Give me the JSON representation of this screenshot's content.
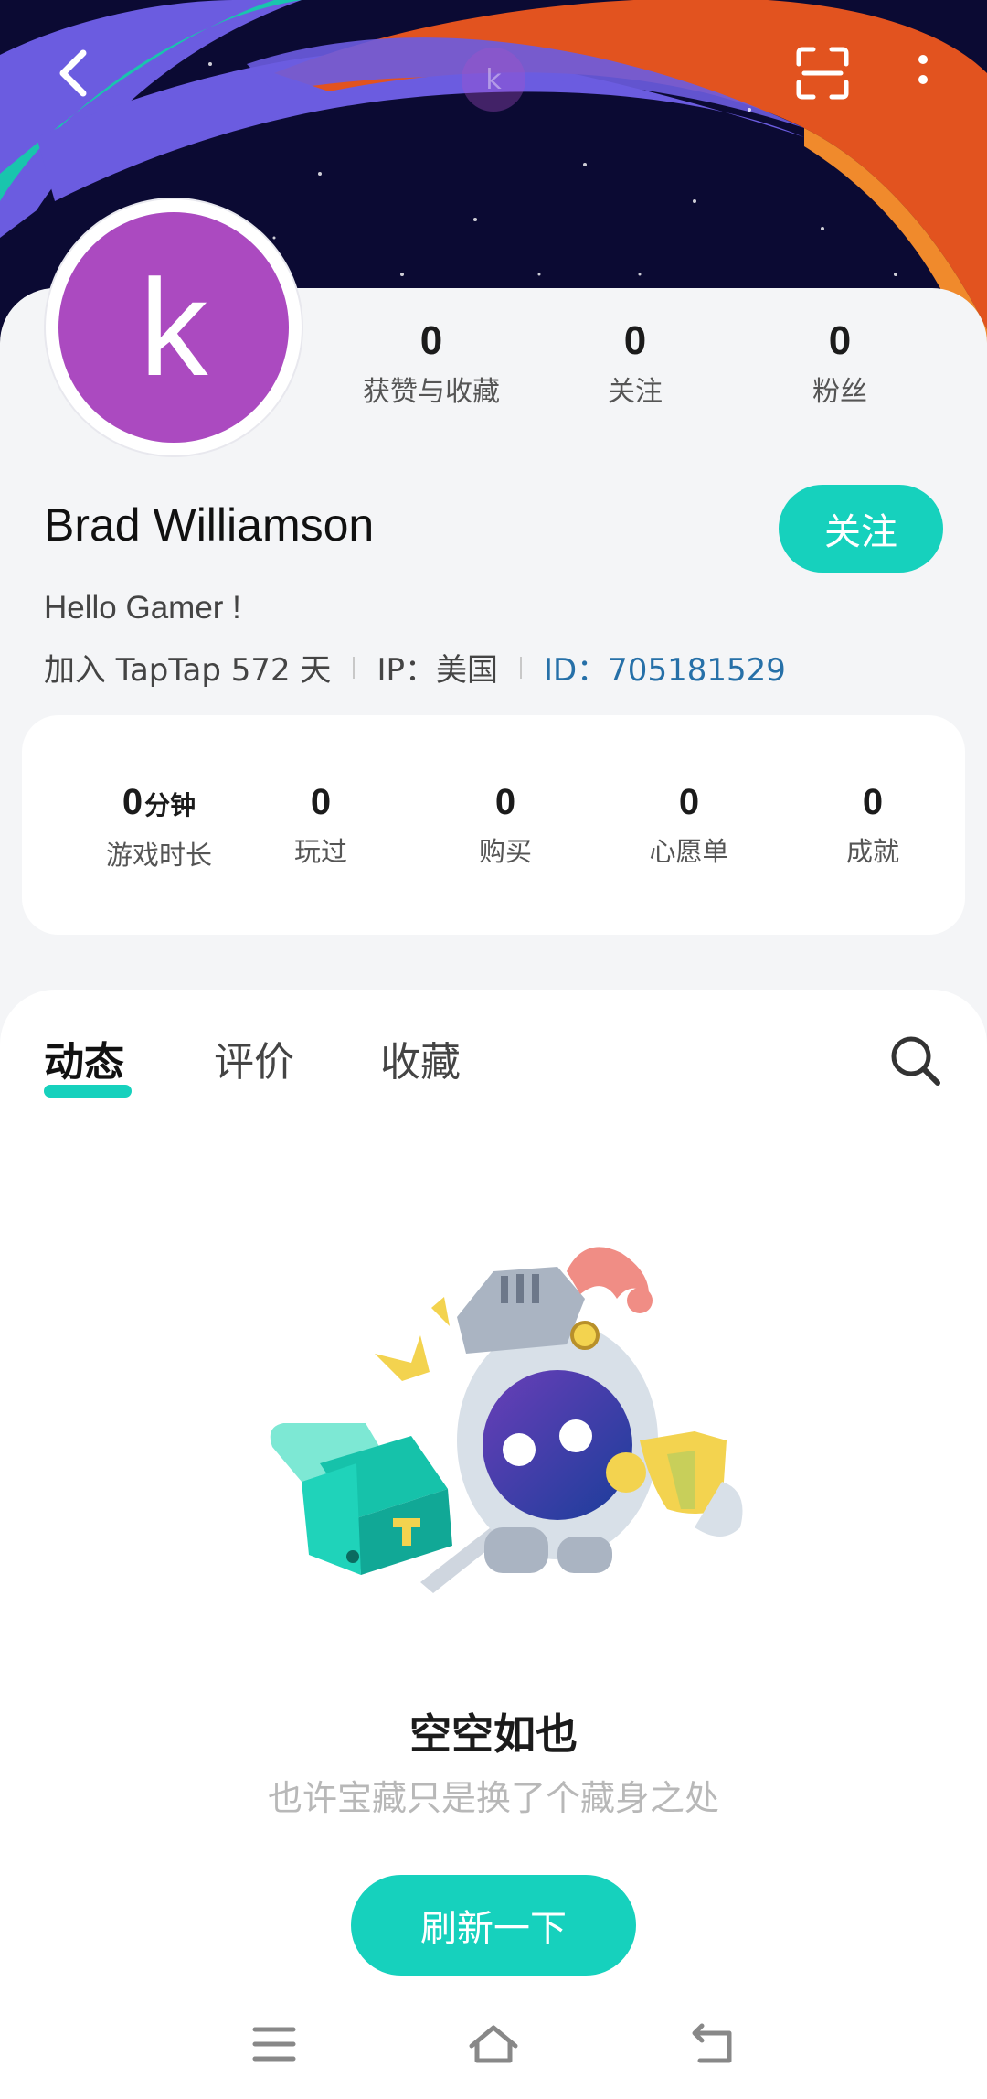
{
  "header": {
    "avatar_letter": "k",
    "back_icon": "chevron-left-icon",
    "scan_icon": "scan-icon",
    "more_icon": "more-vertical-icon"
  },
  "profile": {
    "avatar_letter": "k",
    "avatar_color": "#ab4ac0",
    "name": "Brad Williamson",
    "follow_label": "关注",
    "bio": "Hello Gamer !",
    "joined": "加入 TapTap 572 天",
    "ip": "IP：美国",
    "id": "ID：705181529",
    "stats": [
      {
        "value": "0",
        "label": "获赞与收藏"
      },
      {
        "value": "0",
        "label": "关注"
      },
      {
        "value": "0",
        "label": "粉丝"
      }
    ]
  },
  "game_stats": {
    "playtime_value": "0",
    "playtime_unit": "分钟",
    "playtime_label": "游戏时长",
    "items": [
      {
        "value": "0",
        "label": "玩过"
      },
      {
        "value": "0",
        "label": "购买"
      },
      {
        "value": "0",
        "label": "心愿单"
      },
      {
        "value": "0",
        "label": "成就"
      }
    ]
  },
  "tabs": [
    {
      "label": "动态",
      "active": true
    },
    {
      "label": "评价",
      "active": false
    },
    {
      "label": "收藏",
      "active": false
    }
  ],
  "empty_state": {
    "title": "空空如也",
    "subtitle": "也许宝藏只是换了个藏身之处",
    "button": "刷新一下"
  },
  "colors": {
    "accent": "#16d1bd",
    "id_link": "#2670a8"
  }
}
